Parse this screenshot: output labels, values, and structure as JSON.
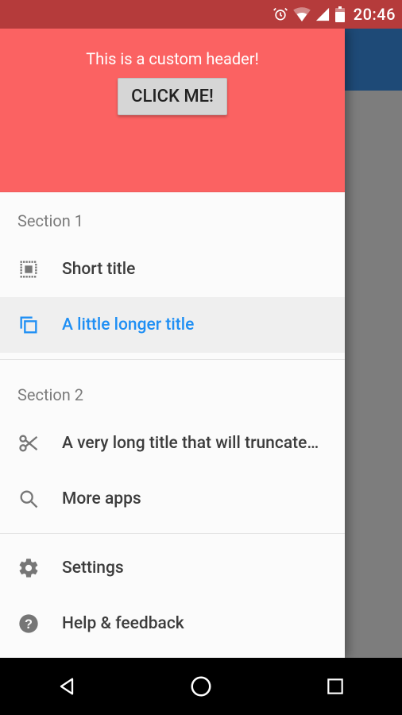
{
  "statusbar": {
    "time": "20:46"
  },
  "header": {
    "title": "This is a custom header!",
    "button_label": "CLICK ME!"
  },
  "sections": {
    "s1_label": "Section 1",
    "s2_label": "Section 2"
  },
  "items": {
    "short": "Short title",
    "longer": "A little longer title",
    "truncated": "A very long title that will truncate…",
    "more_apps": "More apps",
    "settings": "Settings",
    "help": "Help & feedback"
  },
  "colors": {
    "accent": "#1f8ff4",
    "header_bg": "#fb6262",
    "statusbar_bg": "#b53b3b",
    "app_toolbar_bg": "#1e4a77"
  }
}
